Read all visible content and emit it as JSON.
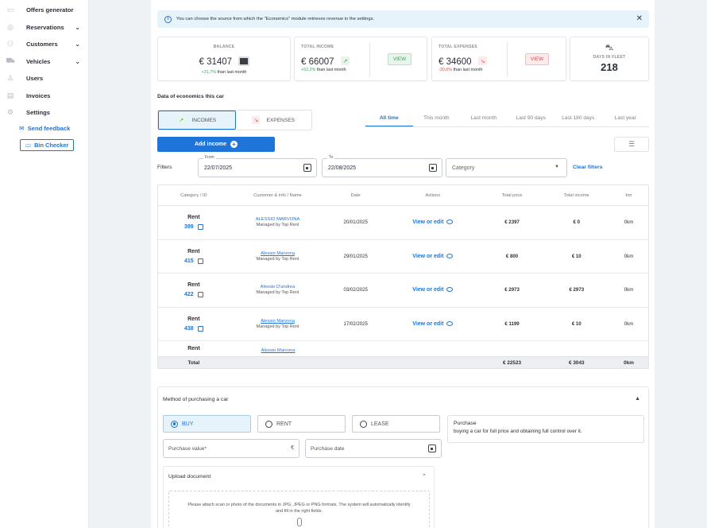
{
  "sidebar": {
    "items": [
      {
        "label": "Offers generator",
        "icon": "offers-icon",
        "chevron": false
      },
      {
        "label": "Reservations",
        "icon": "reservations-icon",
        "chevron": true
      },
      {
        "label": "Customers",
        "icon": "customers-icon",
        "chevron": true
      },
      {
        "label": "Vehicles",
        "icon": "vehicles-icon",
        "chevron": true
      },
      {
        "label": "Users",
        "icon": "users-icon",
        "chevron": false
      },
      {
        "label": "Invoices",
        "icon": "invoices-icon",
        "chevron": false
      },
      {
        "label": "Settings",
        "icon": "gear-icon",
        "chevron": false
      }
    ],
    "send_feedback": "Send feedback",
    "bin_checker": "Bin Checker"
  },
  "info_banner": {
    "text": "You can choose the source from which the \"Economics\" module retrieves revenue in the settings."
  },
  "cards": {
    "balance": {
      "label": "BALANCE",
      "value": "€ 31407",
      "delta": "+31,7%",
      "delta_suffix": " than last month"
    },
    "income": {
      "label": "TOTAL INCOME",
      "value": "€ 66007",
      "delta": "+52,2%",
      "delta_suffix": " than last month",
      "view": "VIEW"
    },
    "expenses": {
      "label": "TOTAL EXPENSES",
      "value": "€ 34600",
      "delta": "-30,6%",
      "delta_suffix": " than last month",
      "view": "VIEW"
    },
    "fleet": {
      "label": "DAYS IN FLEET",
      "value": "218"
    }
  },
  "section_title": "Data of economics this car",
  "toggle": {
    "incomes": "INCOMES",
    "expenses": "EXPENSES"
  },
  "period_tabs": [
    "All time",
    "This month",
    "Last month",
    "Last 90 days",
    "Last 180 days",
    "Last year"
  ],
  "add_income": "Add income",
  "filters": {
    "label": "Filters",
    "from_label": "From",
    "from_value": "22/07/2025",
    "to_label": "To",
    "to_value": "22/08/2025",
    "category_placeholder": "Category",
    "clear": "Clear filters"
  },
  "table": {
    "headers": [
      "Category / ID",
      "Customer & info / Name",
      "Date",
      "Actions",
      "Total price",
      "Total income",
      "km"
    ],
    "rows": [
      {
        "category": "Rent",
        "id": "399",
        "customer": "ALESSIO MARVONA",
        "info": "Managed by Top Rent",
        "date": "20/01/2025",
        "action": "View or edit",
        "price": "€ 2397",
        "income": "€ 0",
        "km": "0km",
        "underline": false
      },
      {
        "category": "Rent",
        "id": "415",
        "customer": "Alessio Marvona",
        "info": "Managed by Top Rent",
        "date": "29/01/2025",
        "action": "View or edit",
        "price": "€ 800",
        "income": "€ 10",
        "km": "0km",
        "underline": true
      },
      {
        "category": "Rent",
        "id": "422",
        "customer": "Alessio D'andrea",
        "info": "Managed by Top Rent",
        "date": "03/02/2025",
        "action": "View or edit",
        "price": "€ 2973",
        "income": "€ 2973",
        "km": "0km",
        "underline": false
      },
      {
        "category": "Rent",
        "id": "438",
        "customer": "Alessio Marvona",
        "info": "Managed by Top Rent",
        "date": "17/02/2025",
        "action": "View or edit",
        "price": "€ 1199",
        "income": "€ 10",
        "km": "0km",
        "underline": true
      },
      {
        "category": "Rent",
        "id": "",
        "customer": "Alessio Marvona",
        "info": "",
        "date": "",
        "action": "",
        "price": "",
        "income": "",
        "km": "",
        "underline": true
      }
    ],
    "total": {
      "label": "Total",
      "price": "€ 22523",
      "income": "€ 3043",
      "km": "0km"
    }
  },
  "purchase": {
    "title": "Method of purchasing a car",
    "options": [
      "BUY",
      "RENT",
      "LEASE"
    ],
    "info_title": "Purchase",
    "info_desc": "buying a car for full price and obtaining full control over it.",
    "value_label": "Purchase value*",
    "currency": "€",
    "date_label": "Purchase date",
    "upload_title": "Upload document",
    "upload_text": "Please attach scan or photo of the documents in JPG, JPEG or PNG formats. The system will automatically identify and fill in the right fields."
  },
  "colors": {
    "accent": "#1e74d8",
    "positive": "#3ba55c",
    "negative": "#e14747",
    "banner": "#e6f3fb"
  }
}
